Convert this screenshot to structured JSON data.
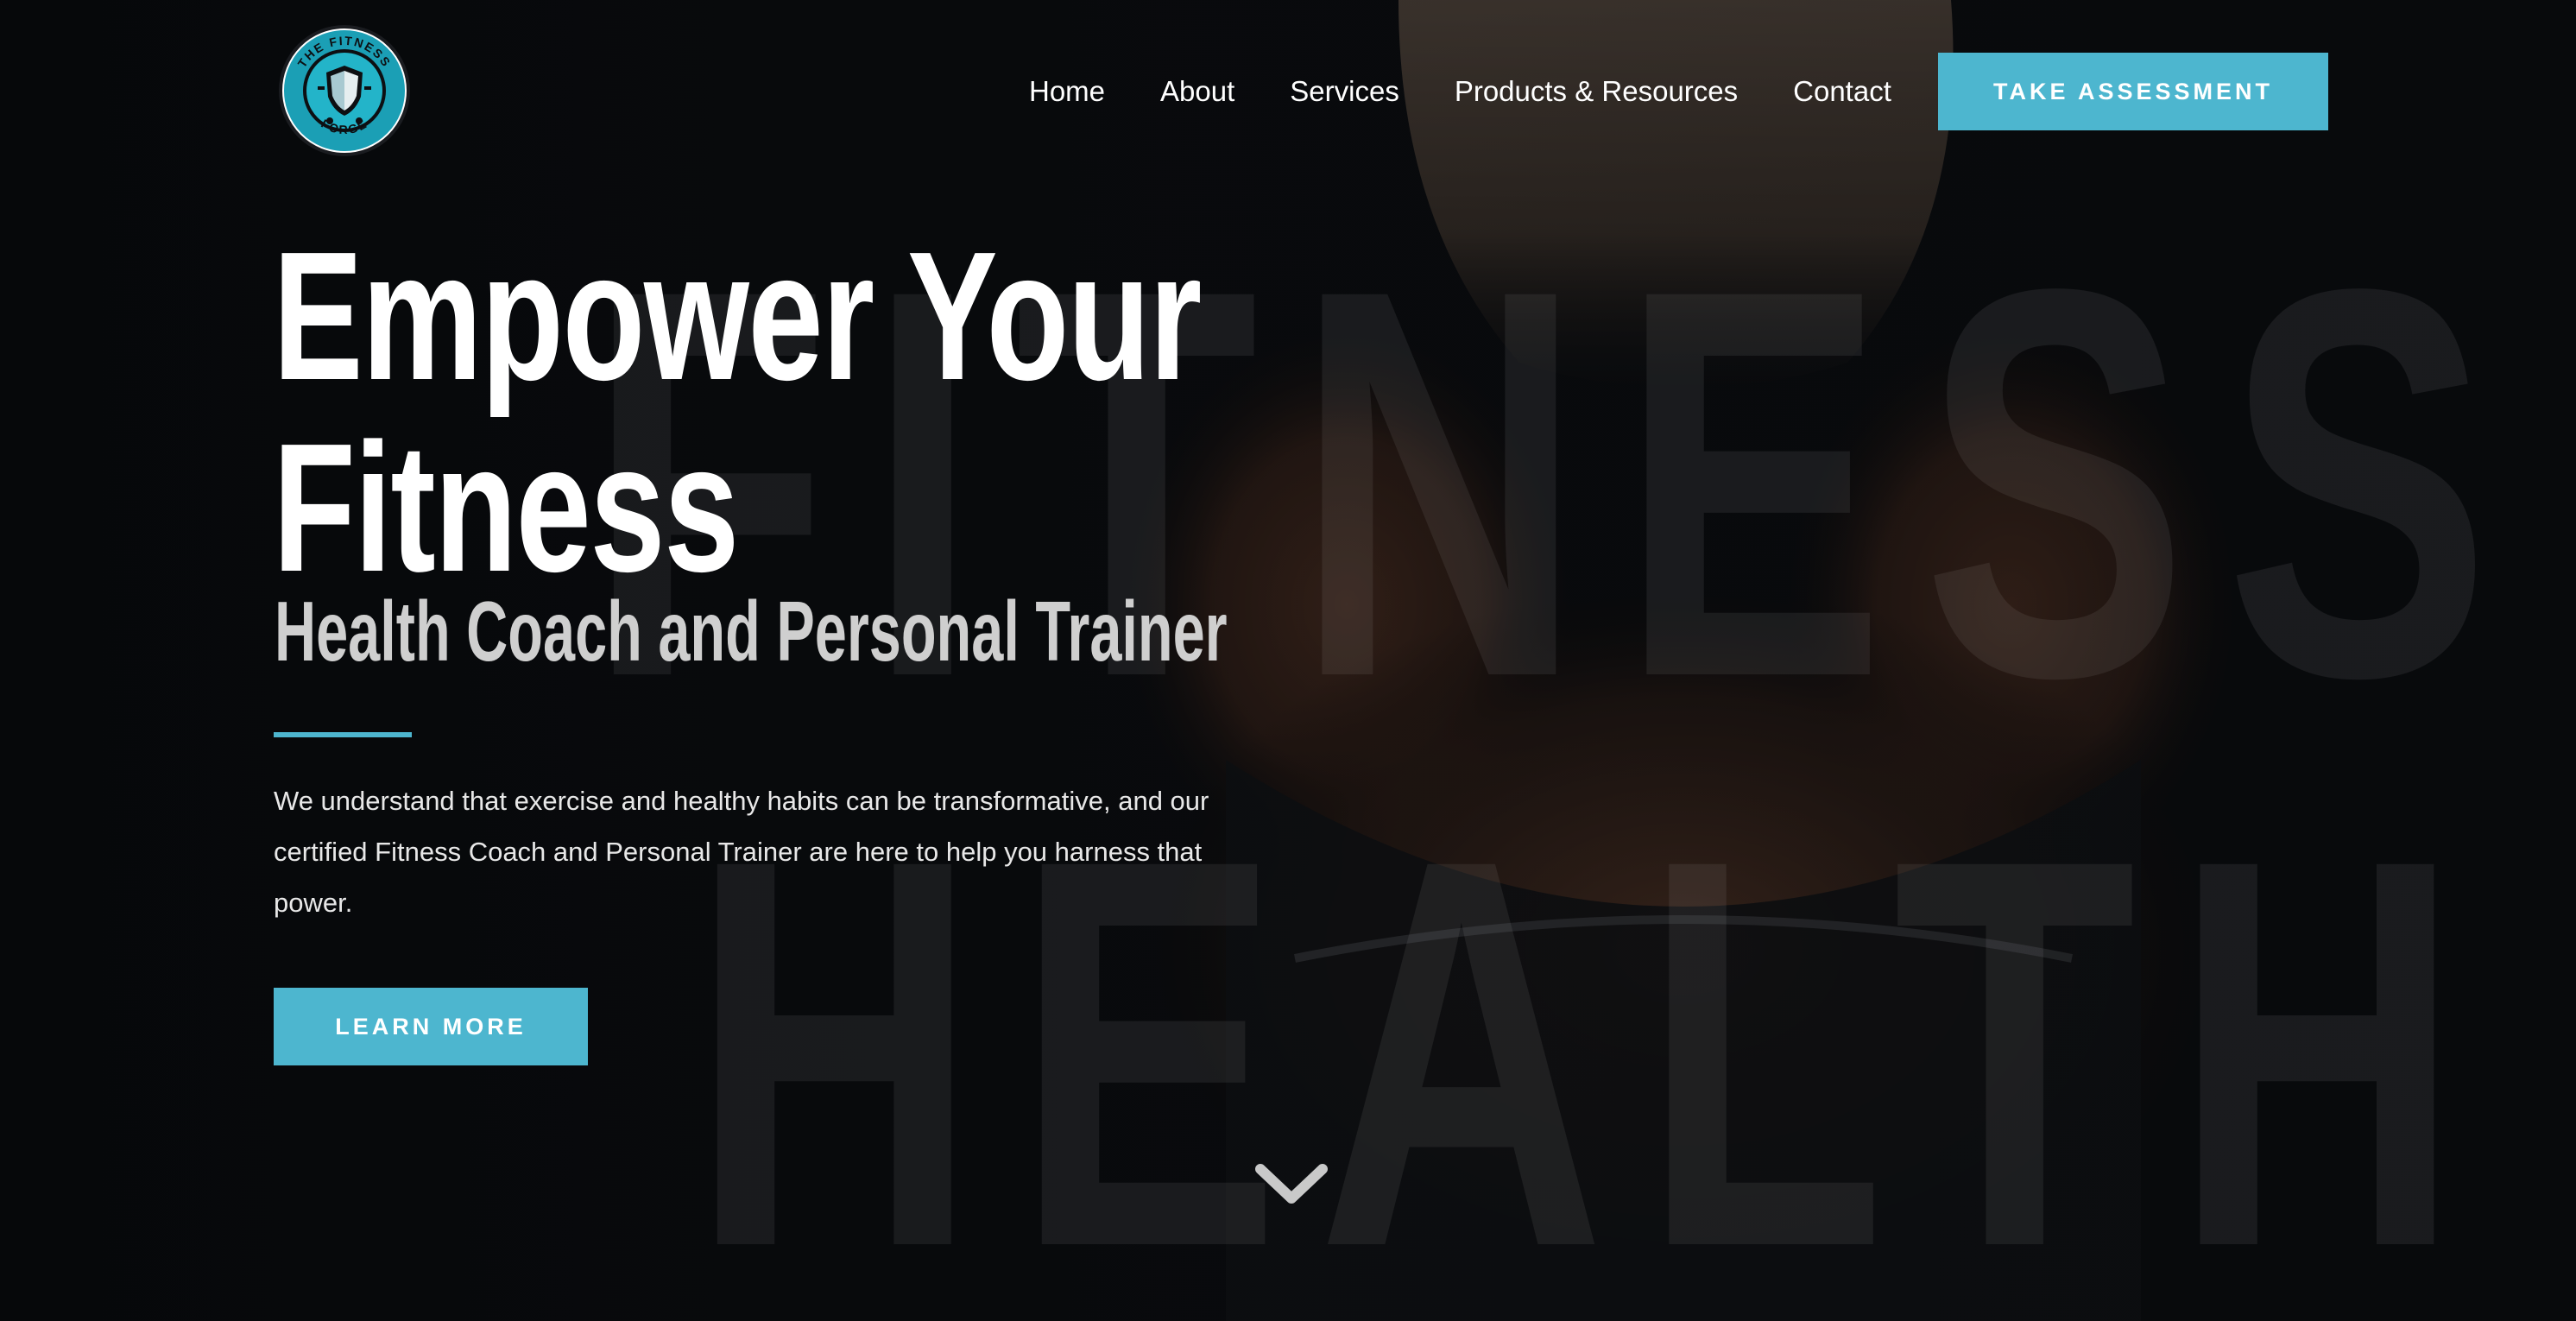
{
  "header": {
    "logo_icon": "the-fitness-forge-logo",
    "logo_text": "THE FITNESS FORGE",
    "nav": [
      {
        "label": "Home"
      },
      {
        "label": "About"
      },
      {
        "label": "Services"
      },
      {
        "label": "Products & Resources"
      },
      {
        "label": "Contact"
      }
    ],
    "cta_label": "TAKE ASSESSMENT"
  },
  "hero": {
    "headline": "Empower Your Fitness",
    "subheadline": "Health Coach and Personal Trainer",
    "body": "We understand that exercise and healthy habits can be transformative, and our certified Fitness Coach and Personal Trainer are here to help you harness that power.",
    "button_label": "LEARN MORE",
    "background_words": [
      "FITNESS",
      "HEALTH"
    ],
    "scroll_icon": "chevron-down-icon"
  },
  "colors": {
    "accent": "#4db6cf",
    "background": "#0a0c0f",
    "text": "#ffffff",
    "subheadline": "#cfcfcf"
  }
}
